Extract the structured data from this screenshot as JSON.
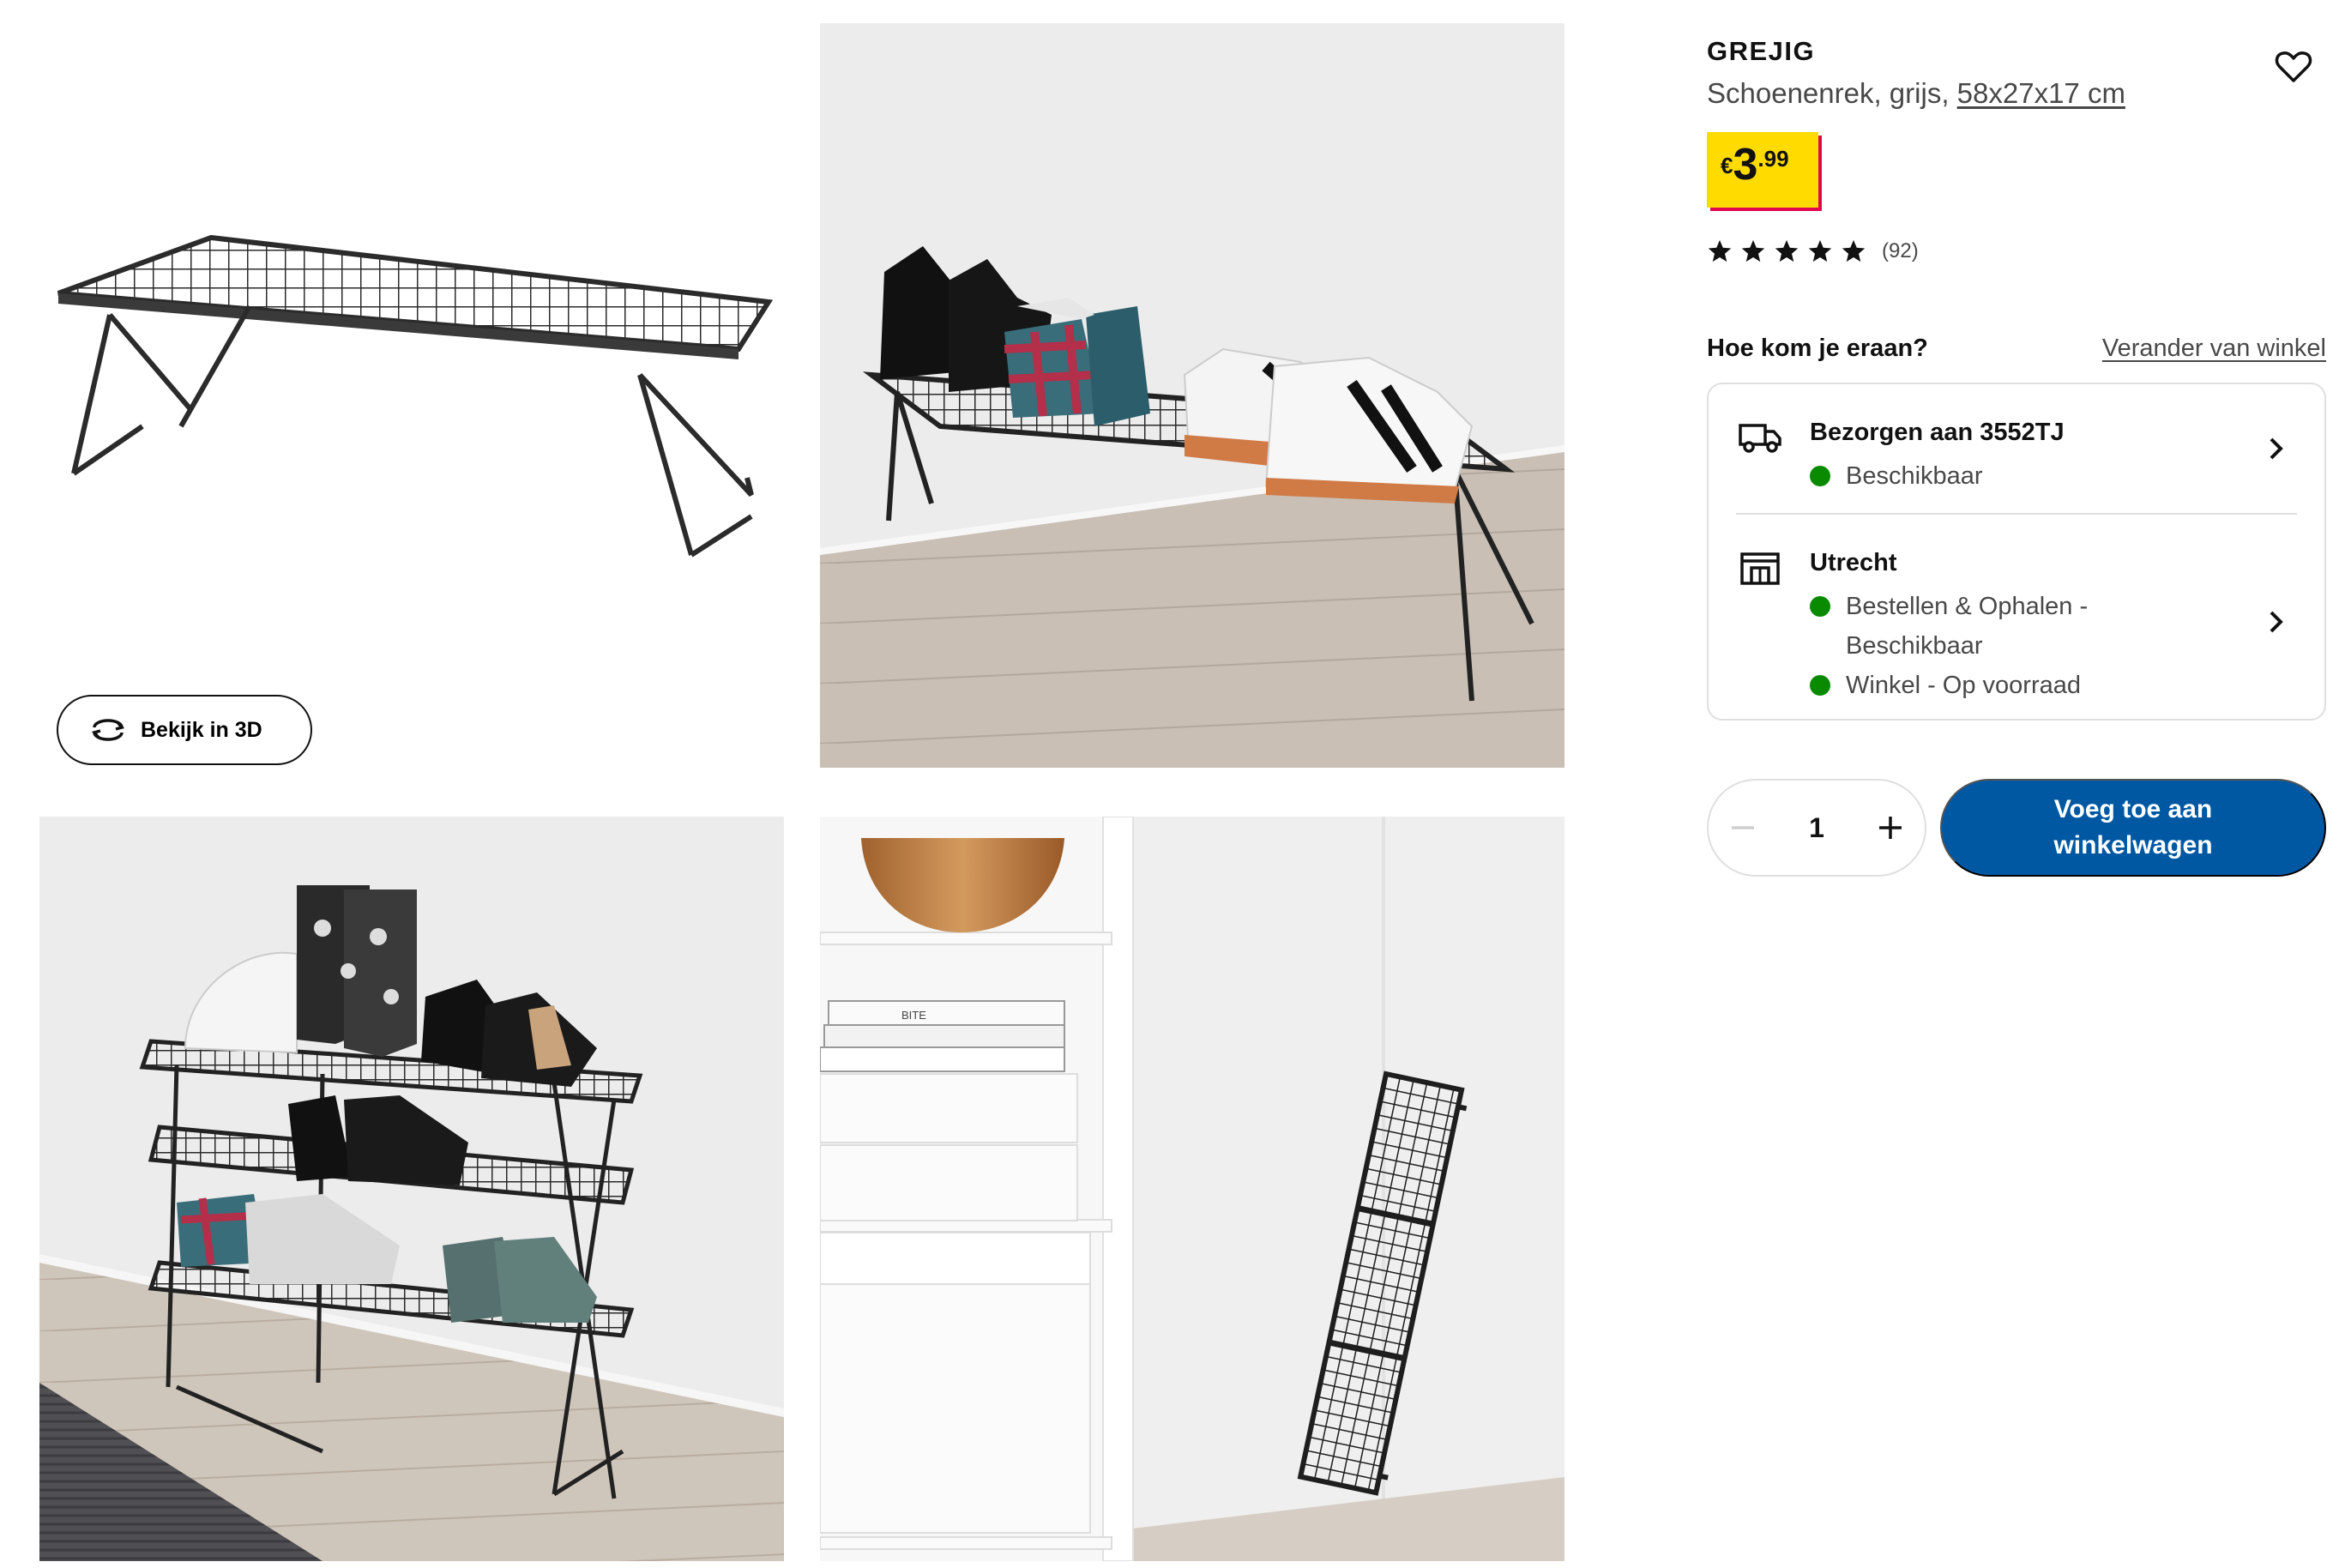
{
  "gallery": {
    "view_3d_label": "Bekijk in 3D",
    "book_label": "BITE"
  },
  "product": {
    "name": "GREJIG",
    "description": "Schoenenrek, grijs,",
    "dimensions": "58x27x17 cm",
    "price": {
      "currency": "€",
      "integer": "3",
      "decimals": ".99"
    },
    "rating": {
      "stars": 5,
      "count": "(92)"
    }
  },
  "availability": {
    "heading": "Hoe kom je eraan?",
    "change_store_label": "Verander van winkel",
    "delivery": {
      "title": "Bezorgen aan 3552TJ",
      "status": "Beschikbaar"
    },
    "store": {
      "title": "Utrecht",
      "status_pickup": "Bestellen & Ophalen - Beschikbaar",
      "status_instore": "Winkel - Op voorraad"
    }
  },
  "cart": {
    "quantity": "1",
    "add_label": "Voeg toe aan winkelwagen"
  },
  "colors": {
    "price_yellow": "#ffdb00",
    "price_shadow": "#e00751",
    "cta_blue": "#0058a3",
    "available_green": "#0a8a00"
  }
}
